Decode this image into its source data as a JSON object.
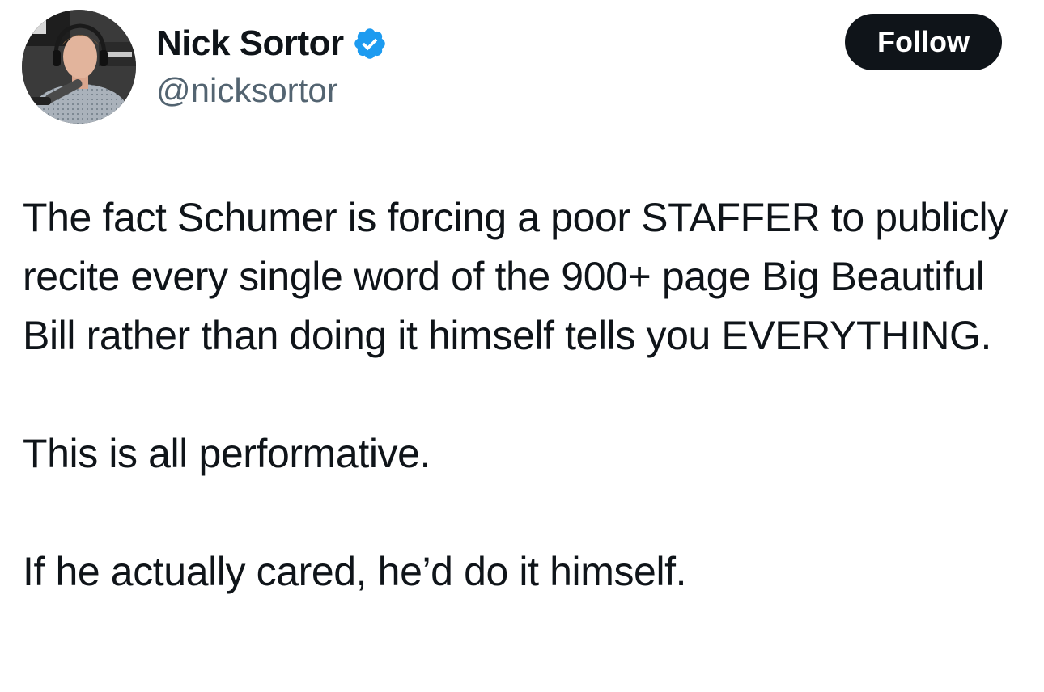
{
  "author": {
    "display_name": "Nick Sortor",
    "handle": "@nicksortor",
    "verified": true,
    "verified_color": "#1d9bf0"
  },
  "follow_button": {
    "label": "Follow",
    "bg_color": "#0f1419"
  },
  "tweet": {
    "paragraphs": [
      "The fact Schumer is forcing a poor STAFFER to publicly recite every single word of the 900+ page Big Beautiful Bill rather than doing it himself tells you EVERYTHING.",
      "This is all performative.",
      "If he actually cared, he’d do it himself."
    ]
  },
  "icons": {
    "avatar": "profile-photo",
    "verified": "verified-badge-icon"
  }
}
